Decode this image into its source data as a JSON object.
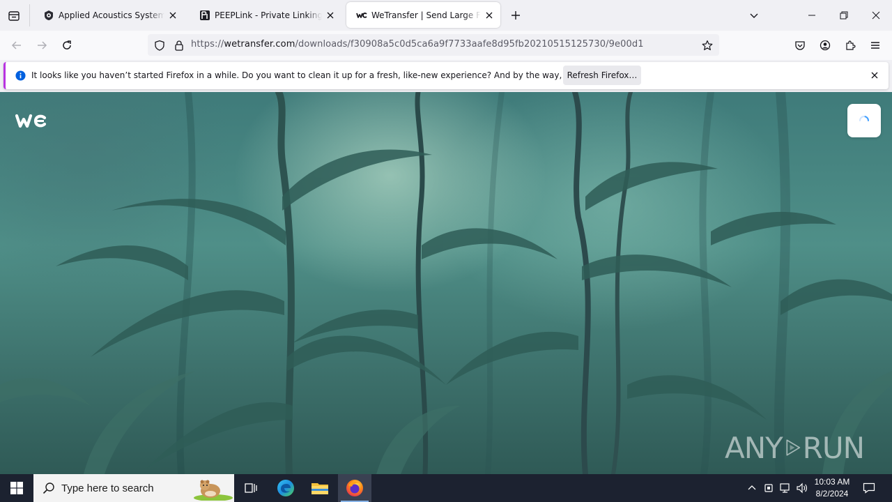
{
  "tabs": [
    {
      "title": "Applied Acoustics Systems Plug",
      "favicon": "aas-shield-icon",
      "selected": false
    },
    {
      "title": "PEEPLink - Private Linking Servi",
      "favicon": "peeplink-icon",
      "selected": false
    },
    {
      "title": "WeTransfer | Send Large Files Fa",
      "favicon": "wetransfer-icon",
      "selected": true
    }
  ],
  "navbar": {
    "url_prefix": "https://",
    "url_host": "wetransfer.com",
    "url_path": "/downloads/f30908a5c0d5ca6a9f7733aafe8d95fb20210515125730/9e00d1"
  },
  "notification": {
    "message": "It looks like you haven’t started Firefox in a while. Do you want to clean it up for a fresh, like-new experience? And by the way, welcome back!",
    "button_label": "Refresh Firefox…"
  },
  "watermark": {
    "left": "ANY",
    "right": "RUN"
  },
  "taskbar": {
    "search_placeholder": "Type here to search",
    "time": "10:03 AM",
    "date": "8/2/2024"
  },
  "colors": {
    "accent_purple": "#b833e1",
    "info_blue": "#0060df",
    "taskbar_bg": "#1c2230"
  }
}
